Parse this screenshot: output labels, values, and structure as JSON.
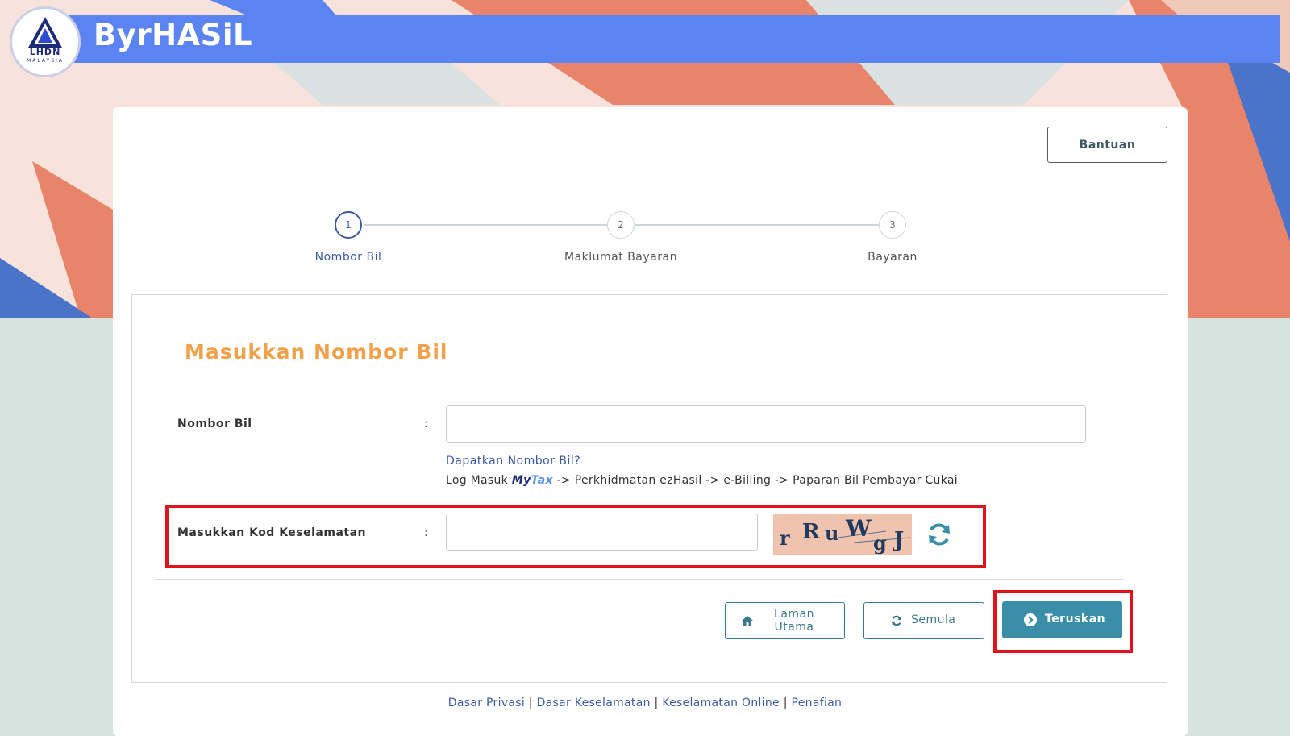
{
  "header": {
    "app_title": "ByrHASiL",
    "logo_text": "LHDN",
    "logo_subtext": "MALAYSIA"
  },
  "help_button": {
    "label": "Bantuan"
  },
  "steps": [
    {
      "number": "1",
      "label": "Nombor Bil",
      "active": true
    },
    {
      "number": "2",
      "label": "Maklumat Bayaran",
      "active": false
    },
    {
      "number": "3",
      "label": "Bayaran",
      "active": false
    }
  ],
  "form": {
    "title": "Masukkan Nombor Bil",
    "bill_field": {
      "label": "Nombor Bil",
      "colon": ":",
      "value": ""
    },
    "help_link": "Dapatkan Nombor Bil?",
    "help_path_prefix": "Log Masuk",
    "mytax_my": "My",
    "mytax_tax": "Tax",
    "help_path_suffix": "-> Perkhidmatan ezHasil -> e-Billing -> Paparan Bil Pembayar Cukai",
    "captcha_field": {
      "label": "Masukkan Kod Keselamatan",
      "colon": ":",
      "value": ""
    },
    "captcha_chars": [
      "r",
      "R",
      "u",
      "W",
      "g",
      "J"
    ],
    "refresh_icon": "refresh-icon"
  },
  "buttons": {
    "home_label_line1": "Laman",
    "home_label_line2": "Utama",
    "reset_label": "Semula",
    "continue_label": "Teruskan"
  },
  "footer": {
    "links": [
      "Dasar Privasi",
      "Dasar Keselamatan",
      "Keselamatan Online",
      "Penafian"
    ],
    "separator": "|"
  },
  "colors": {
    "header_blue": "#5b83f2",
    "title_orange": "#f0a14a",
    "primary_teal": "#3a8ea8",
    "highlight_red": "#e0121a",
    "link_blue": "#3a5ba6"
  }
}
